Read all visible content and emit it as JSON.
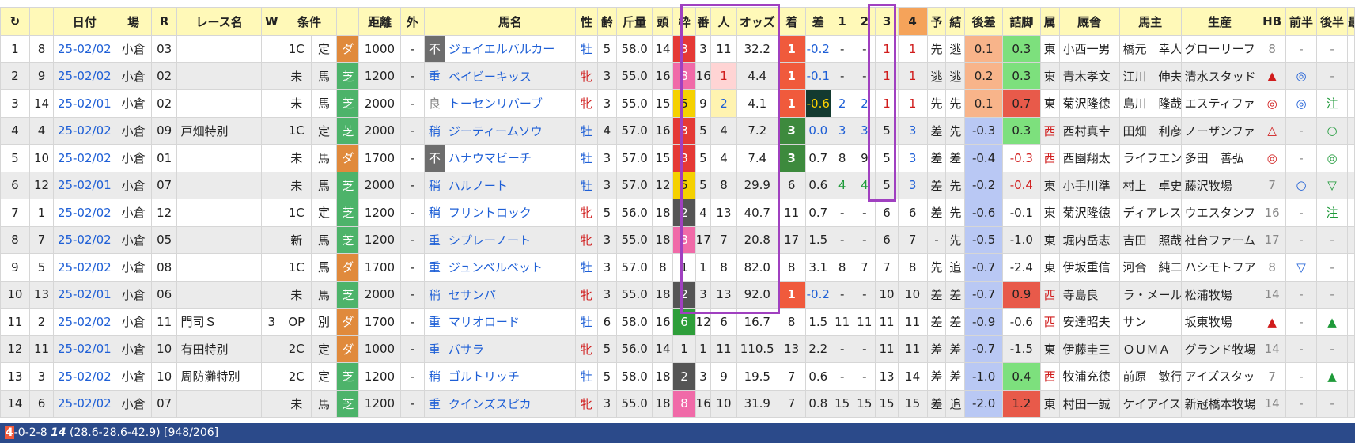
{
  "header": {
    "reload_icon": "↻",
    "cols": [
      "日付",
      "場",
      "R",
      "レース名",
      "W",
      "条件",
      "",
      "距離",
      "外",
      "",
      "馬名",
      "性",
      "齢",
      "斤量",
      "頭",
      "枠",
      "番",
      "人",
      "オッズ",
      "着",
      "差",
      "1",
      "2",
      "3",
      "4",
      "予",
      "結",
      "後差",
      "詰脚",
      "属",
      "厩舎",
      "馬主",
      "生産",
      "HB",
      "前半",
      "後半",
      "最"
    ]
  },
  "rows": [
    {
      "n": "1",
      "a": "8",
      "date": "25-02/02",
      "place": "小倉",
      "r": "03",
      "race": "",
      "w": "",
      "cond": "1C",
      "kind": "定",
      "surf": "ダ",
      "dist": "1000",
      "out": "-",
      "cnd": "不",
      "horse": "ジェイエルバルカー",
      "sex": "牡",
      "age": "5",
      "wt": "58.0",
      "heads": "14",
      "waku": "3",
      "ban": "3",
      "pop": "11",
      "odds": "32.2",
      "rank": "1",
      "diff": "-0.2",
      "c1": "-",
      "c2": "-",
      "c3": "1",
      "c4": "1",
      "yo": "先",
      "ke": "逃",
      "ato": "0.1",
      "tsume": "0.3",
      "zoku": "東",
      "trainer": "小西一男",
      "owner": "橋元　幸人",
      "breeder": "グローリーフ",
      "hb": "8",
      "zen": "-",
      "kou": "-"
    },
    {
      "n": "2",
      "a": "9",
      "date": "25-02/02",
      "place": "小倉",
      "r": "02",
      "race": "",
      "w": "",
      "cond": "未",
      "kind": "馬",
      "surf": "芝",
      "dist": "1200",
      "out": "-",
      "cnd": "重",
      "horse": "ベイビーキッス",
      "sex": "牝",
      "age": "3",
      "wt": "55.0",
      "heads": "16",
      "waku": "8",
      "ban": "16",
      "pop": "1",
      "odds": "4.4",
      "rank": "1",
      "diff": "-0.1",
      "c1": "-",
      "c2": "-",
      "c3": "1",
      "c4": "1",
      "yo": "逃",
      "ke": "逃",
      "ato": "0.2",
      "tsume": "0.3",
      "zoku": "東",
      "trainer": "青木孝文",
      "owner": "江川　伸夫",
      "breeder": "清水スタッド",
      "hb": "▲",
      "zen": "◎",
      "kou": "-"
    },
    {
      "n": "3",
      "a": "14",
      "date": "25-02/01",
      "place": "小倉",
      "r": "02",
      "race": "",
      "w": "",
      "cond": "未",
      "kind": "馬",
      "surf": "芝",
      "dist": "2000",
      "out": "-",
      "cnd": "良",
      "horse": "トーセンリバーブ",
      "sex": "牝",
      "age": "3",
      "wt": "55.0",
      "heads": "15",
      "waku": "5",
      "ban": "9",
      "pop": "2",
      "odds": "4.1",
      "rank": "1",
      "diff": "-0.6",
      "c1": "2",
      "c2": "2",
      "c3": "1",
      "c4": "1",
      "yo": "先",
      "ke": "先",
      "ato": "0.1",
      "tsume": "0.7",
      "zoku": "東",
      "trainer": "菊沢隆徳",
      "owner": "島川　隆哉",
      "breeder": "エスティファ",
      "hb": "◎",
      "zen": "◎",
      "kou": "注"
    },
    {
      "n": "4",
      "a": "4",
      "date": "25-02/02",
      "place": "小倉",
      "r": "09",
      "race": "戸畑特別",
      "w": "",
      "cond": "1C",
      "kind": "定",
      "surf": "芝",
      "dist": "2000",
      "out": "-",
      "cnd": "稍",
      "horse": "ジーティームソウ",
      "sex": "牡",
      "age": "4",
      "wt": "57.0",
      "heads": "16",
      "waku": "3",
      "ban": "5",
      "pop": "4",
      "odds": "7.2",
      "rank": "3",
      "diff": "0.0",
      "c1": "3",
      "c2": "3",
      "c3": "5",
      "c4": "3",
      "yo": "差",
      "ke": "先",
      "ato": "-0.3",
      "tsume": "0.3",
      "zoku": "西",
      "trainer": "西村真幸",
      "owner": "田畑　利彦",
      "breeder": "ノーザンファ",
      "hb": "△",
      "zen": "-",
      "kou": "○"
    },
    {
      "n": "5",
      "a": "10",
      "date": "25-02/02",
      "place": "小倉",
      "r": "01",
      "race": "",
      "w": "",
      "cond": "未",
      "kind": "馬",
      "surf": "ダ",
      "dist": "1700",
      "out": "-",
      "cnd": "不",
      "horse": "ハナウマビーチ",
      "sex": "牡",
      "age": "3",
      "wt": "57.0",
      "heads": "15",
      "waku": "3",
      "ban": "5",
      "pop": "4",
      "odds": "7.4",
      "rank": "3",
      "diff": "0.7",
      "c1": "8",
      "c2": "9",
      "c3": "5",
      "c4": "3",
      "yo": "差",
      "ke": "差",
      "ato": "-0.4",
      "tsume": "-0.3",
      "zoku": "西",
      "trainer": "西園翔太",
      "owner": "ライフエンタ",
      "breeder": "多田　善弘",
      "hb": "◎",
      "zen": "-",
      "kou": "◎"
    },
    {
      "n": "6",
      "a": "12",
      "date": "25-02/01",
      "place": "小倉",
      "r": "07",
      "race": "",
      "w": "",
      "cond": "未",
      "kind": "馬",
      "surf": "芝",
      "dist": "2000",
      "out": "-",
      "cnd": "稍",
      "horse": "ハルノート",
      "sex": "牡",
      "age": "3",
      "wt": "57.0",
      "heads": "12",
      "waku": "5",
      "ban": "5",
      "pop": "8",
      "odds": "29.9",
      "rank": "6",
      "diff": "0.6",
      "c1": "4",
      "c2": "4",
      "c3": "5",
      "c4": "3",
      "yo": "差",
      "ke": "先",
      "ato": "-0.2",
      "tsume": "-0.4",
      "zoku": "東",
      "trainer": "小手川準",
      "owner": "村上　卓史",
      "breeder": "藤沢牧場",
      "hb": "7",
      "zen": "○",
      "kou": "▽"
    },
    {
      "n": "7",
      "a": "1",
      "date": "25-02/02",
      "place": "小倉",
      "r": "12",
      "race": "",
      "w": "",
      "cond": "1C",
      "kind": "定",
      "surf": "芝",
      "dist": "1200",
      "out": "-",
      "cnd": "稍",
      "horse": "フリントロック",
      "sex": "牝",
      "age": "5",
      "wt": "56.0",
      "heads": "18",
      "waku": "2",
      "ban": "4",
      "pop": "13",
      "odds": "40.7",
      "rank": "11",
      "diff": "0.7",
      "c1": "-",
      "c2": "-",
      "c3": "6",
      "c4": "6",
      "yo": "差",
      "ke": "先",
      "ato": "-0.6",
      "tsume": "-0.1",
      "zoku": "東",
      "trainer": "菊沢隆徳",
      "owner": "ディアレスト",
      "breeder": "ウエスタンフ",
      "hb": "16",
      "zen": "-",
      "kou": "注"
    },
    {
      "n": "8",
      "a": "7",
      "date": "25-02/02",
      "place": "小倉",
      "r": "05",
      "race": "",
      "w": "",
      "cond": "新",
      "kind": "馬",
      "surf": "芝",
      "dist": "1200",
      "out": "-",
      "cnd": "重",
      "horse": "シプレーノート",
      "sex": "牝",
      "age": "3",
      "wt": "55.0",
      "heads": "18",
      "waku": "8",
      "ban": "17",
      "pop": "7",
      "odds": "20.8",
      "rank": "17",
      "diff": "1.5",
      "c1": "-",
      "c2": "-",
      "c3": "6",
      "c4": "7",
      "yo": "-",
      "ke": "先",
      "ato": "-0.5",
      "tsume": "-1.0",
      "zoku": "東",
      "trainer": "堀内岳志",
      "owner": "吉田　照哉",
      "breeder": "社台ファーム",
      "hb": "17",
      "zen": "-",
      "kou": "-"
    },
    {
      "n": "9",
      "a": "5",
      "date": "25-02/02",
      "place": "小倉",
      "r": "08",
      "race": "",
      "w": "",
      "cond": "1C",
      "kind": "馬",
      "surf": "ダ",
      "dist": "1700",
      "out": "-",
      "cnd": "重",
      "horse": "ジュンベルベット",
      "sex": "牡",
      "age": "3",
      "wt": "57.0",
      "heads": "8",
      "waku": "1",
      "ban": "1",
      "pop": "8",
      "odds": "82.0",
      "rank": "8",
      "diff": "3.1",
      "c1": "8",
      "c2": "7",
      "c3": "7",
      "c4": "8",
      "yo": "先",
      "ke": "追",
      "ato": "-0.7",
      "tsume": "-2.4",
      "zoku": "東",
      "trainer": "伊坂重信",
      "owner": "河合　純二",
      "breeder": "ハシモトフア",
      "hb": "8",
      "zen": "▽",
      "kou": "-"
    },
    {
      "n": "10",
      "a": "13",
      "date": "25-02/01",
      "place": "小倉",
      "r": "06",
      "race": "",
      "w": "",
      "cond": "未",
      "kind": "馬",
      "surf": "芝",
      "dist": "2000",
      "out": "-",
      "cnd": "稍",
      "horse": "セサンパ",
      "sex": "牝",
      "age": "3",
      "wt": "55.0",
      "heads": "18",
      "waku": "2",
      "ban": "3",
      "pop": "13",
      "odds": "92.0",
      "rank": "1",
      "diff": "-0.2",
      "c1": "-",
      "c2": "-",
      "c3": "10",
      "c4": "10",
      "yo": "差",
      "ke": "差",
      "ato": "-0.7",
      "tsume": "0.9",
      "zoku": "西",
      "trainer": "寺島良",
      "owner": "ラ・メール",
      "breeder": "松浦牧場",
      "hb": "14",
      "zen": "-",
      "kou": "-"
    },
    {
      "n": "11",
      "a": "2",
      "date": "25-02/02",
      "place": "小倉",
      "r": "11",
      "race": "門司Ｓ",
      "w": "3",
      "cond": "OP",
      "kind": "別",
      "surf": "ダ",
      "dist": "1700",
      "out": "-",
      "cnd": "重",
      "horse": "マリオロード",
      "sex": "牡",
      "age": "6",
      "wt": "58.0",
      "heads": "16",
      "waku": "6",
      "ban": "12",
      "pop": "6",
      "odds": "16.7",
      "rank": "8",
      "diff": "1.5",
      "c1": "11",
      "c2": "11",
      "c3": "11",
      "c4": "11",
      "yo": "差",
      "ke": "差",
      "ato": "-0.9",
      "tsume": "-0.6",
      "zoku": "西",
      "trainer": "安達昭夫",
      "owner": "サン",
      "breeder": "坂東牧場",
      "hb": "▲",
      "zen": "-",
      "kou": "▲"
    },
    {
      "n": "12",
      "a": "11",
      "date": "25-02/01",
      "place": "小倉",
      "r": "10",
      "race": "有田特別",
      "w": "",
      "cond": "2C",
      "kind": "定",
      "surf": "ダ",
      "dist": "1000",
      "out": "-",
      "cnd": "重",
      "horse": "バサラ",
      "sex": "牝",
      "age": "5",
      "wt": "56.0",
      "heads": "14",
      "waku": "1",
      "ban": "1",
      "pop": "11",
      "odds": "110.5",
      "rank": "13",
      "diff": "2.2",
      "c1": "-",
      "c2": "-",
      "c3": "11",
      "c4": "11",
      "yo": "差",
      "ke": "差",
      "ato": "-0.7",
      "tsume": "-1.5",
      "zoku": "東",
      "trainer": "伊藤圭三",
      "owner": "ＯＵＭＡ",
      "breeder": "グランド牧場",
      "hb": "14",
      "zen": "-",
      "kou": "-"
    },
    {
      "n": "13",
      "a": "3",
      "date": "25-02/02",
      "place": "小倉",
      "r": "10",
      "race": "周防灘特別",
      "w": "",
      "cond": "2C",
      "kind": "定",
      "surf": "芝",
      "dist": "1200",
      "out": "-",
      "cnd": "稍",
      "horse": "ゴルトリッチ",
      "sex": "牡",
      "age": "5",
      "wt": "58.0",
      "heads": "18",
      "waku": "2",
      "ban": "3",
      "pop": "9",
      "odds": "19.5",
      "rank": "7",
      "diff": "0.6",
      "c1": "-",
      "c2": "-",
      "c3": "13",
      "c4": "14",
      "yo": "差",
      "ke": "差",
      "ato": "-1.0",
      "tsume": "0.4",
      "zoku": "西",
      "trainer": "牧浦充徳",
      "owner": "前原　敏行",
      "breeder": "アイズスタッ",
      "hb": "7",
      "zen": "-",
      "kou": "▲"
    },
    {
      "n": "14",
      "a": "6",
      "date": "25-02/02",
      "place": "小倉",
      "r": "07",
      "race": "",
      "w": "",
      "cond": "未",
      "kind": "馬",
      "surf": "芝",
      "dist": "1200",
      "out": "-",
      "cnd": "重",
      "horse": "クインズスピカ",
      "sex": "牝",
      "age": "3",
      "wt": "55.0",
      "heads": "18",
      "waku": "8",
      "ban": "16",
      "pop": "10",
      "odds": "31.9",
      "rank": "7",
      "diff": "0.8",
      "c1": "15",
      "c2": "15",
      "c3": "15",
      "c4": "15",
      "yo": "差",
      "ke": "追",
      "ato": "-2.0",
      "tsume": "1.2",
      "zoku": "東",
      "trainer": "村田一誠",
      "owner": "ケイアイスタ",
      "breeder": "新冠橋本牧場",
      "hb": "14",
      "zen": "-",
      "kou": "-"
    }
  ],
  "footer": {
    "wins": "4",
    "record": "-0-2-8",
    "count": "14",
    "split": "(28.6-28.6-42.9)",
    "extra": "[948/206]"
  }
}
